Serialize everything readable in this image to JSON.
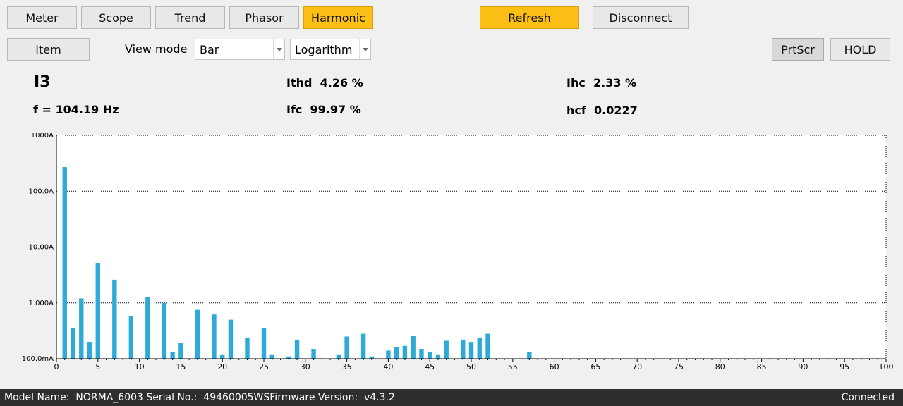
{
  "tabs": [
    {
      "label": "Meter",
      "active": false
    },
    {
      "label": "Scope",
      "active": false
    },
    {
      "label": "Trend",
      "active": false
    },
    {
      "label": "Phasor",
      "active": false
    },
    {
      "label": "Harmonic",
      "active": true
    }
  ],
  "toolbar": {
    "refresh_label": "Refresh",
    "disconnect_label": "Disconnect",
    "item_label": "Item",
    "view_mode_label": "View mode",
    "view_mode_value": "Bar",
    "scale_value": "Logarithm",
    "prtscr_label": "PrtScr",
    "hold_label": "HOLD"
  },
  "measurements": {
    "channel": "I3",
    "frequency": "f = 104.19 Hz",
    "ithd_name": "Ithd",
    "ithd_value": "4.26 %",
    "ifc_name": "Ifc",
    "ifc_value": "99.97 %",
    "ihc_name": "Ihc",
    "ihc_value": "2.33 %",
    "hcf_name": "hcf",
    "hcf_value": "0.0227"
  },
  "colors": {
    "bar": "#2eaad8",
    "accent": "#fcbf16",
    "statusbar": "#2e2e2e"
  },
  "chart_data": {
    "type": "bar",
    "yscale": "log",
    "ylim": [
      0.1,
      1000
    ],
    "xlim": [
      0,
      100
    ],
    "ytick_labels": [
      "1000A",
      "100.0A",
      "10.00A",
      "1.000A",
      "100.0mA"
    ],
    "ytick_values": [
      1000,
      100,
      10,
      1,
      0.1
    ],
    "xtick_values": [
      0,
      5,
      10,
      15,
      20,
      25,
      30,
      35,
      40,
      45,
      50,
      55,
      60,
      65,
      70,
      75,
      80,
      85,
      90,
      95,
      100
    ],
    "grid": "horizontal-dotted",
    "unit": "A",
    "x": [
      1,
      2,
      3,
      4,
      5,
      7,
      9,
      11,
      13,
      14,
      15,
      17,
      19,
      20,
      21,
      23,
      25,
      26,
      28,
      29,
      31,
      34,
      35,
      37,
      38,
      40,
      41,
      42,
      43,
      44,
      45,
      46,
      47,
      49,
      50,
      51,
      52,
      57
    ],
    "values": [
      270,
      0.35,
      1.2,
      0.2,
      5.2,
      2.6,
      0.57,
      1.25,
      1.0,
      0.13,
      0.19,
      0.75,
      0.62,
      0.12,
      0.5,
      0.24,
      0.36,
      0.12,
      0.11,
      0.22,
      0.15,
      0.12,
      0.25,
      0.28,
      0.11,
      0.14,
      0.16,
      0.17,
      0.26,
      0.15,
      0.13,
      0.12,
      0.21,
      0.22,
      0.2,
      0.24,
      0.28,
      0.13
    ]
  },
  "status": {
    "device_info": "Model Name:  NORMA_6003 Serial No.:  49460005WSFirmware Version:  v4.3.2",
    "connection": "Connected"
  }
}
